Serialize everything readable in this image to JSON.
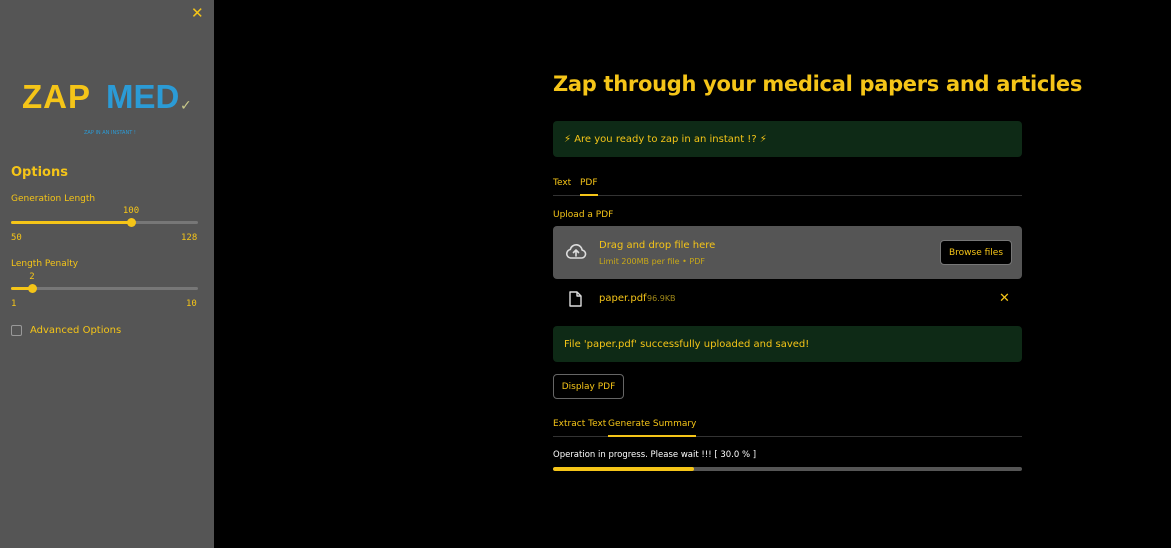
{
  "sidebar": {
    "close_label": "✕",
    "logo": {
      "word1": "ZAP",
      "word2": "MED",
      "tagline": "ZAP IN AN INSTANT !"
    },
    "options_heading": "Options",
    "generation_length": {
      "label": "Generation Length",
      "value": "100",
      "min": "50",
      "max": "128"
    },
    "length_penalty": {
      "label": "Length Penalty",
      "value": "2",
      "min": "1",
      "max": "10"
    },
    "advanced_options_label": "Advanced Options"
  },
  "main": {
    "title": "Zap through your medical papers and articles",
    "banner": "⚡ Are you ready to zap in an instant !? ⚡",
    "input_tabs": [
      {
        "label": "Text",
        "active": false
      },
      {
        "label": "PDF",
        "active": true
      }
    ],
    "upload_label": "Upload a PDF",
    "dropzone": {
      "main_text": "Drag and drop file here",
      "sub_text": "Limit 200MB per file • PDF",
      "browse_label": "Browse files"
    },
    "file": {
      "name": "paper.pdf",
      "size": "96.9KB",
      "delete_label": "✕"
    },
    "success_message": "File 'paper.pdf' successfully uploaded and saved!",
    "display_pdf_label": "Display PDF",
    "action_tabs": [
      {
        "label": "Extract Text",
        "active": false
      },
      {
        "label": "Generate Summary",
        "active": true
      }
    ],
    "progress": {
      "text": "Operation in progress. Please wait !!! [ 30.0 % ]",
      "fraction": 0.3
    }
  },
  "colors": {
    "accent": "#f5c518",
    "logo_blue": "#2b9bd6",
    "sidebar_bg": "#555555",
    "success_bg": "#0e2a16",
    "page_bg": "#000000"
  }
}
